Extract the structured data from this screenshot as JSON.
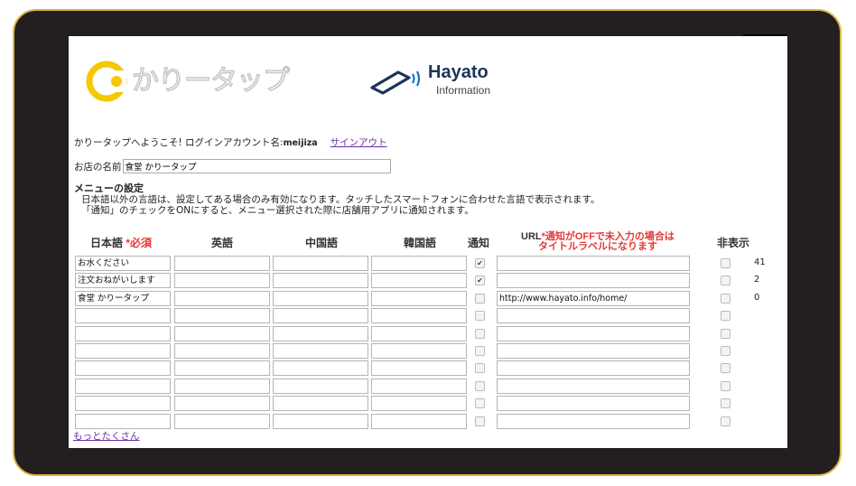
{
  "welcome": {
    "prefix": "かりータップへようこそ! ログインアカウント名:",
    "account": "meijiza",
    "signout": "サインアウト"
  },
  "shop": {
    "label": "お店の名前",
    "value": "食堂 かりータップ"
  },
  "menu_settings": {
    "heading": "メニューの設定",
    "desc1": "日本語以外の言語は、設定してある場合のみ有効になります。タッチしたスマートフォンに合わせた言語で表示されます。",
    "desc2": "「通知」のチェックをONにすると、メニュー選択された際に店舗用アプリに通知されます。"
  },
  "logo": {
    "kari": "かりータップ",
    "hayato": "Hayato",
    "hayato_sub": "Information"
  },
  "columns": {
    "japanese": "日本語",
    "required": "*必須",
    "english": "英語",
    "chinese": "中国語",
    "korean": "韓国語",
    "notify": "通知",
    "url_prefix": "URL",
    "url_note_1": "*通知がOFFで未入力の場合は",
    "url_note_2": "タイトルラベルになります",
    "hide": "非表示"
  },
  "rows": [
    {
      "ja": "お水ください",
      "en": "",
      "zh": "",
      "ko": "",
      "notify": true,
      "url": "",
      "hidden": false,
      "count": "41"
    },
    {
      "ja": "注文おねがいします",
      "en": "",
      "zh": "",
      "ko": "",
      "notify": true,
      "url": "",
      "hidden": false,
      "count": "2"
    },
    {
      "ja": "食堂 かりータップ",
      "en": "",
      "zh": "",
      "ko": "",
      "notify": false,
      "url": "http://www.hayato.info/home/",
      "hidden": false,
      "count": "0"
    },
    {
      "ja": "",
      "en": "",
      "zh": "",
      "ko": "",
      "notify": false,
      "url": "",
      "hidden": false,
      "count": ""
    },
    {
      "ja": "",
      "en": "",
      "zh": "",
      "ko": "",
      "notify": false,
      "url": "",
      "hidden": false,
      "count": ""
    },
    {
      "ja": "",
      "en": "",
      "zh": "",
      "ko": "",
      "notify": false,
      "url": "",
      "hidden": false,
      "count": ""
    },
    {
      "ja": "",
      "en": "",
      "zh": "",
      "ko": "",
      "notify": false,
      "url": "",
      "hidden": false,
      "count": ""
    },
    {
      "ja": "",
      "en": "",
      "zh": "",
      "ko": "",
      "notify": false,
      "url": "",
      "hidden": false,
      "count": ""
    },
    {
      "ja": "",
      "en": "",
      "zh": "",
      "ko": "",
      "notify": false,
      "url": "",
      "hidden": false,
      "count": ""
    },
    {
      "ja": "",
      "en": "",
      "zh": "",
      "ko": "",
      "notify": false,
      "url": "",
      "hidden": false,
      "count": ""
    }
  ],
  "more_link": "もっとたくさん",
  "colors": {
    "frame": "#231f20",
    "frame_border": "#d9b842",
    "required": "#e53935",
    "link": "#6a2ea8",
    "hayato_blue": "#1d3557"
  }
}
